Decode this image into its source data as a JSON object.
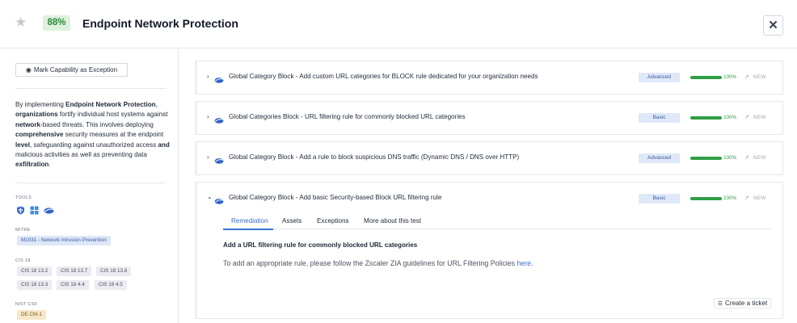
{
  "header": {
    "score": "88%",
    "title": "Endpoint Network Protection",
    "star_icon": "star-icon",
    "close_icon": "close-icon"
  },
  "sidebar": {
    "mark_exception_label": "Mark Capability as Exception",
    "description": {
      "p1": "By implementing ",
      "b1": "Endpoint Network Protection",
      "p2": ", ",
      "b2": "organizations",
      "p3": " fortify individual host systems against ",
      "b3": "network",
      "p4": "-based threats. This involves deploying ",
      "b4": "comprehensive",
      "p5": " security measures at the endpoint ",
      "b5": "level",
      "p6": ", safeguarding against unauthorized access ",
      "b6": "and",
      "p7": " malicious activities as well as preventing data ",
      "b7": "exfiltration",
      "p8": "."
    },
    "tools_label": "TOOLS",
    "tools": [
      "shield-icon",
      "windows-icon",
      "cloud-icon"
    ],
    "mitre_label": "MITRE",
    "mitre_tag": "M1031 - Network Intrusion Prevention",
    "cis_label": "CIS 18",
    "cis_tags": [
      "CIS 18 13.2",
      "CIS 18 13.7",
      "CIS 18 13.8",
      "CIS 18 13.3",
      "CIS 18 4.4",
      "CIS 18 4.5"
    ],
    "nist_label": "NIST CSF",
    "nist_tag": "DE.CM-1"
  },
  "tests": [
    {
      "title": "Global Category Block - Add custom URL categories for BLOCK rule dedicated for your organization needs",
      "level": "Advanced",
      "progress": 100,
      "progress_label": "100%",
      "status": "NEW",
      "expanded": false
    },
    {
      "title": "Global Categories Block - URL filtering rule for commonly blocked URL categories",
      "level": "Basic",
      "progress": 100,
      "progress_label": "100%",
      "status": "NEW",
      "expanded": false
    },
    {
      "title": "Global Category Block - Add a rule to block suspicious DNS traffic (Dynamic DNS / DNS over HTTP)",
      "level": "Advanced",
      "progress": 100,
      "progress_label": "100%",
      "status": "NEW",
      "expanded": false
    },
    {
      "title": "Global Category Block - Add basic Security-based Block URL filtering rule",
      "level": "Basic",
      "progress": 100,
      "progress_label": "100%",
      "status": "NEW",
      "expanded": true
    }
  ],
  "expanded_test": {
    "tabs": [
      "Remediation",
      "Assets",
      "Exceptions",
      "More about this test"
    ],
    "active_tab": "Remediation",
    "remediation_heading": "Add a URL filtering rule for commonly blocked URL categories",
    "remediation_text": "To add an appropriate rule, please follow the Zscaler ZIA guidelines for URL Filtering Policies ",
    "remediation_link": "here",
    "remediation_end": ".",
    "ticket_label": "Create a ticket"
  },
  "colors": {
    "score_bg": "#ddf1dd",
    "score_fg": "#2f8a3a",
    "progress": "#2f9e44",
    "badge_bg": "#dfe8f8",
    "badge_fg": "#3b5aa6",
    "tab_active": "#3b6fd1",
    "nist_bg": "#f8e8c9",
    "cis_bg": "#ecebf1"
  }
}
